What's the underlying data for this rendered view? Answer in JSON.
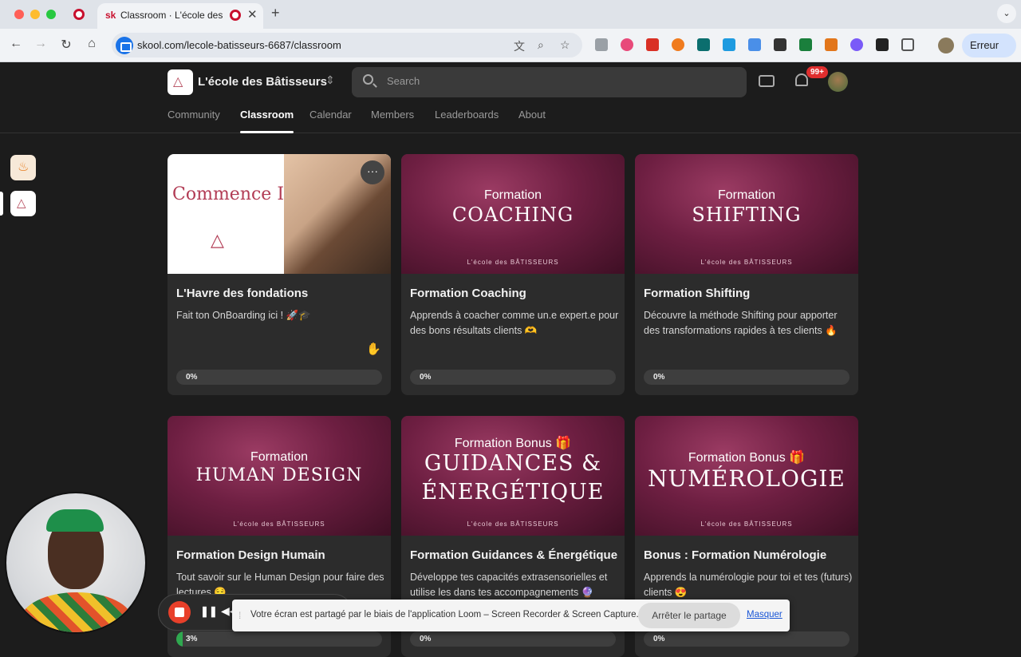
{
  "browser": {
    "tab_title": "Classroom · L'école des B",
    "tab_favicon": "sk",
    "url": "skool.com/lecole-batisseurs-6687/classroom",
    "profile_button": "Erreur",
    "new_tab": "+",
    "tab_close": "✕"
  },
  "header": {
    "community_name": "L'école des Bâtisseurs",
    "search_placeholder": "Search",
    "notification_count": "99+"
  },
  "nav": {
    "items": [
      {
        "label": "Community",
        "active": false
      },
      {
        "label": "Classroom",
        "active": true
      },
      {
        "label": "Calendar",
        "active": false
      },
      {
        "label": "Members",
        "active": false
      },
      {
        "label": "Leaderboards",
        "active": false
      },
      {
        "label": "About",
        "active": false
      }
    ]
  },
  "courses": [
    {
      "cover_text": "Commence ICI !",
      "title": "L'Havre des fondations",
      "description": "Fait ton OnBoarding ici ! 🚀🎓",
      "progress_label": "0%",
      "progress": 0
    },
    {
      "cover_top": "Formation",
      "cover_big": "COACHING",
      "title": "Formation Coaching",
      "description": "Apprends à coacher comme un.e expert.e pour des bons résultats clients 🫶",
      "progress_label": "0%",
      "progress": 0
    },
    {
      "cover_top": "Formation",
      "cover_big": "SHIFTING",
      "title": "Formation Shifting",
      "description": "Découvre la méthode Shifting pour apporter des transformations rapides à tes clients 🔥",
      "progress_label": "0%",
      "progress": 0
    },
    {
      "cover_top": "Formation",
      "cover_big": "HUMAN DESIGN",
      "title": "Formation Design Humain",
      "description": "Tout savoir sur le Human Design pour faire des lectures 😌",
      "progress_label": "3%",
      "progress": 3
    },
    {
      "cover_top": "Formation Bonus 🎁",
      "cover_big": "GUIDANCES &",
      "cover_big2": "ÉNERGÉTIQUE",
      "title": "Formation Guidances & Énergétique",
      "description": "Développe tes capacités extrasensorielles et utilise les dans tes accompagnements 🔮",
      "progress_label": "0%",
      "progress": 0
    },
    {
      "cover_top": "Formation Bonus 🎁",
      "cover_big": "NUMÉROLOGIE",
      "title": "Bonus : Formation Numérologie",
      "description": "Apprends la numérologie pour toi et tes (futurs) clients 😍",
      "progress_label": "0%",
      "progress": 0
    }
  ],
  "cover_brand": "L'école des BÂTISSEURS",
  "share_banner": {
    "text": "Votre écran est partagé par le biais de l'application Loom – Screen Recorder & Screen Capture.",
    "stop_label": "Arrêter le partage",
    "hide_label": "Masquer"
  },
  "colors": {
    "accent_red": "#e02e2e",
    "progress_green": "#2fa84f",
    "cover_wine": "#6e1f42"
  }
}
